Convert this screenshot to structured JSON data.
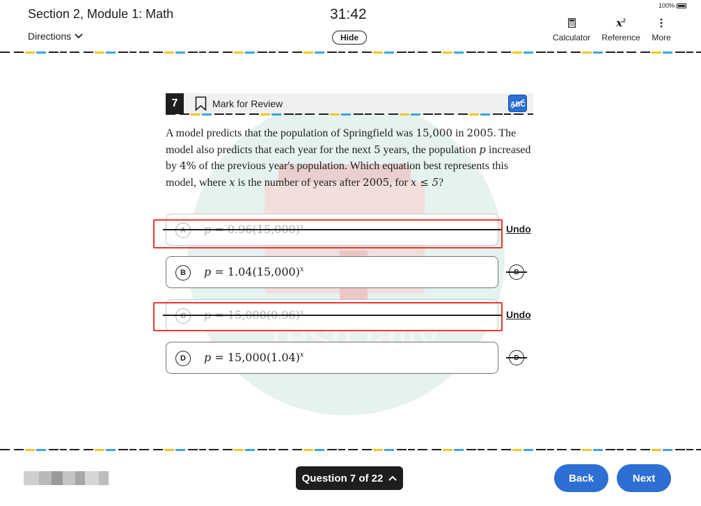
{
  "header": {
    "section_title": "Section 2, Module 1: Math",
    "directions_label": "Directions",
    "timer": "31:42",
    "hide_label": "Hide",
    "battery": "100%",
    "tools": [
      {
        "label": "Calculator",
        "icon": "calculator-icon"
      },
      {
        "label": "Reference",
        "icon": "reference-icon"
      },
      {
        "label": "More",
        "icon": "more-vertical-icon"
      }
    ]
  },
  "question": {
    "number": "7",
    "mark_for_review": "Mark for Review",
    "abc_label": "ABC",
    "text_parts": [
      "A model predicts that the population of Springfield was ",
      "15,000",
      " in ",
      "2005",
      ". The model also predicts that each year for the next ",
      "5",
      " years, the population ",
      "p",
      " increased by ",
      "4%",
      " of the previous year's population. Which equation best represents this model, where ",
      "x",
      " is the number of years after ",
      "2005",
      ", for ",
      "x ≤ 5",
      "?"
    ],
    "choices": [
      {
        "letter": "A",
        "lhs": "p",
        "rhs": " = 0.96(15,000)",
        "exp": "x",
        "state": "crossed",
        "action": "Undo"
      },
      {
        "letter": "B",
        "lhs": "p",
        "rhs": " = 1.04(15,000)",
        "exp": "x",
        "state": "normal",
        "action": "B"
      },
      {
        "letter": "C",
        "lhs": "p",
        "rhs": " = 15,000(0.96)",
        "exp": "x",
        "state": "crossed",
        "action": "Undo"
      },
      {
        "letter": "D",
        "lhs": "p",
        "rhs": " = 15,000(1.04)",
        "exp": "x",
        "state": "normal",
        "action": "D"
      }
    ]
  },
  "watermark": "TestDaily",
  "footer": {
    "question_nav": "Question 7 of 22",
    "back_label": "Back",
    "next_label": "Next"
  },
  "colors": {
    "accent_blue": "#2d6fd2",
    "highlight_red": "#e8372f",
    "dash_yellow": "#f3c623",
    "dash_blue": "#3aa6e0"
  }
}
